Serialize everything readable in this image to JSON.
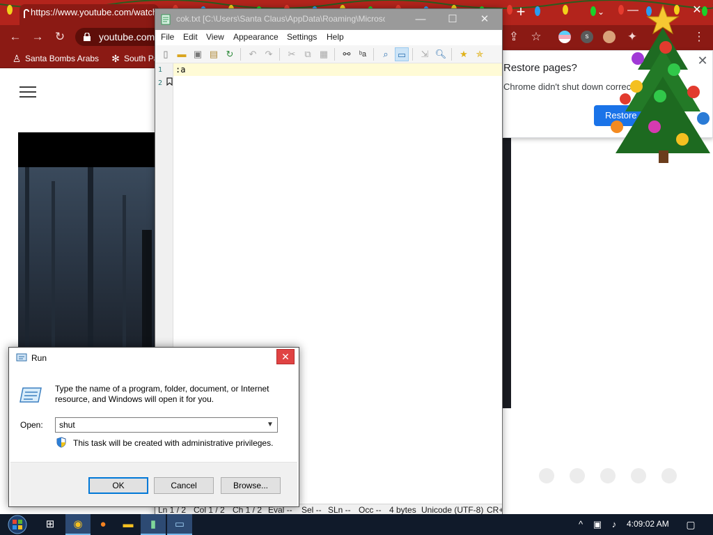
{
  "chrome": {
    "tab_url": "https://www.youtube.com/watch",
    "omnibox_host": "youtube.com",
    "bookmarks": [
      "Santa Bombs Arabs",
      "South Park"
    ],
    "restore": {
      "title": "Restore pages?",
      "body": "Chrome didn't shut down correctly.",
      "button": "Restore"
    }
  },
  "notepad": {
    "title": "cok.txt [C:\\Users\\Santa Claus\\AppData\\Roaming\\Microsoft\\...",
    "menus": [
      "File",
      "Edit",
      "View",
      "Appearance",
      "Settings",
      "Help"
    ],
    "lines": [
      ":a",
      ""
    ],
    "line_numbers": [
      "1",
      "2"
    ],
    "status": {
      "ln": "Ln 1 / 2",
      "col": "Col 1 / 2",
      "ch": "Ch 1 / 2",
      "eval": "Eval --",
      "sel": "Sel --",
      "sln": "SLn --",
      "occ": "Occ --",
      "size": "4 bytes",
      "encoding": "Unicode (UTF-8)",
      "eol": "CR+LF"
    }
  },
  "run_dialog": {
    "title": "Run",
    "description": "Type the name of a program, folder, document, or Internet resource, and Windows will open it for you.",
    "open_label": "Open:",
    "input_value": "shut",
    "admin_note": "This task will be created with administrative privileges.",
    "ok_label": "OK",
    "cancel_label": "Cancel",
    "browse_label": "Browse..."
  },
  "taskbar": {
    "clock": "4:09:02 AM"
  },
  "colors": {
    "chrome_theme": "#8b1a14",
    "accent_blue": "#1a73e8",
    "run_default_border": "#0078d7",
    "taskbar": "#101a2a"
  }
}
